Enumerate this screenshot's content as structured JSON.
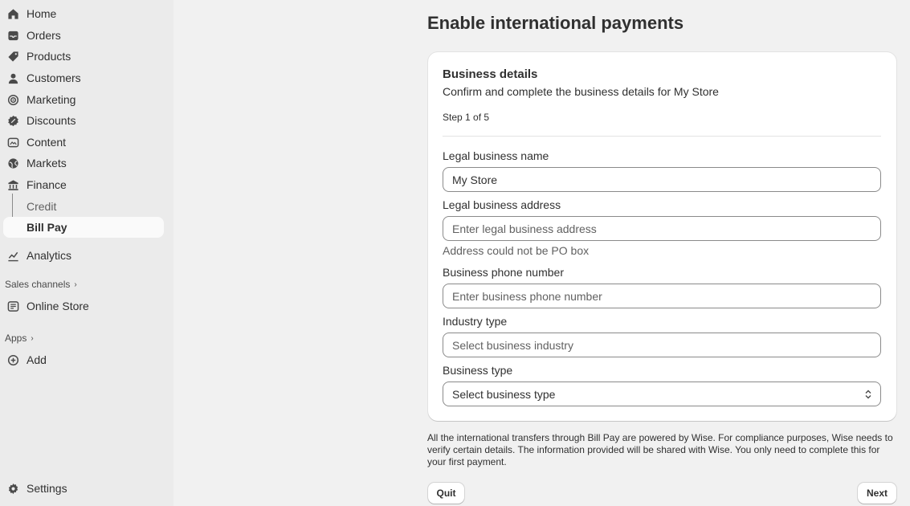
{
  "sidebar": {
    "items": [
      {
        "label": "Home",
        "icon": "home-icon"
      },
      {
        "label": "Orders",
        "icon": "inbox-icon"
      },
      {
        "label": "Products",
        "icon": "tag-icon"
      },
      {
        "label": "Customers",
        "icon": "person-icon"
      },
      {
        "label": "Marketing",
        "icon": "target-icon"
      },
      {
        "label": "Discounts",
        "icon": "discount-icon"
      },
      {
        "label": "Content",
        "icon": "content-icon"
      },
      {
        "label": "Markets",
        "icon": "globe-icon"
      },
      {
        "label": "Finance",
        "icon": "bank-icon"
      }
    ],
    "finance_sub": [
      {
        "label": "Credit"
      },
      {
        "label": "Bill Pay"
      }
    ],
    "analytics": {
      "label": "Analytics",
      "icon": "chart-icon"
    },
    "sales_channels": {
      "label": "Sales channels",
      "icon": "chevron-right-icon"
    },
    "online_store": {
      "label": "Online Store",
      "icon": "store-icon"
    },
    "apps": {
      "label": "Apps",
      "icon": "chevron-right-icon"
    },
    "add": {
      "label": "Add",
      "icon": "plus-circle-icon"
    },
    "settings": {
      "label": "Settings",
      "icon": "gear-icon"
    }
  },
  "main": {
    "title": "Enable international payments",
    "card": {
      "title": "Business details",
      "subtitle": "Confirm and complete the business details for My Store",
      "step": "Step 1 of 5",
      "fields": {
        "legal_name": {
          "label": "Legal business name",
          "value": "My Store"
        },
        "legal_address": {
          "label": "Legal business address",
          "placeholder": "Enter legal business address",
          "help": "Address could not be PO box"
        },
        "phone": {
          "label": "Business phone number",
          "placeholder": "Enter business phone number"
        },
        "industry": {
          "label": "Industry type",
          "placeholder": "Select business industry"
        },
        "business_type": {
          "label": "Business type",
          "value": "Select business type"
        }
      }
    },
    "disclaimer": "All the international transfers through Bill Pay are powered by Wise. For compliance purposes, Wise needs to verify certain details. The information provided will be shared with Wise. You only need to complete this for your first payment.",
    "buttons": {
      "quit": "Quit",
      "next": "Next"
    }
  },
  "colors": {
    "sidebar_bg": "#ebebeb",
    "page_bg": "#f1f1f1",
    "text": "#303030",
    "muted": "#616161"
  }
}
